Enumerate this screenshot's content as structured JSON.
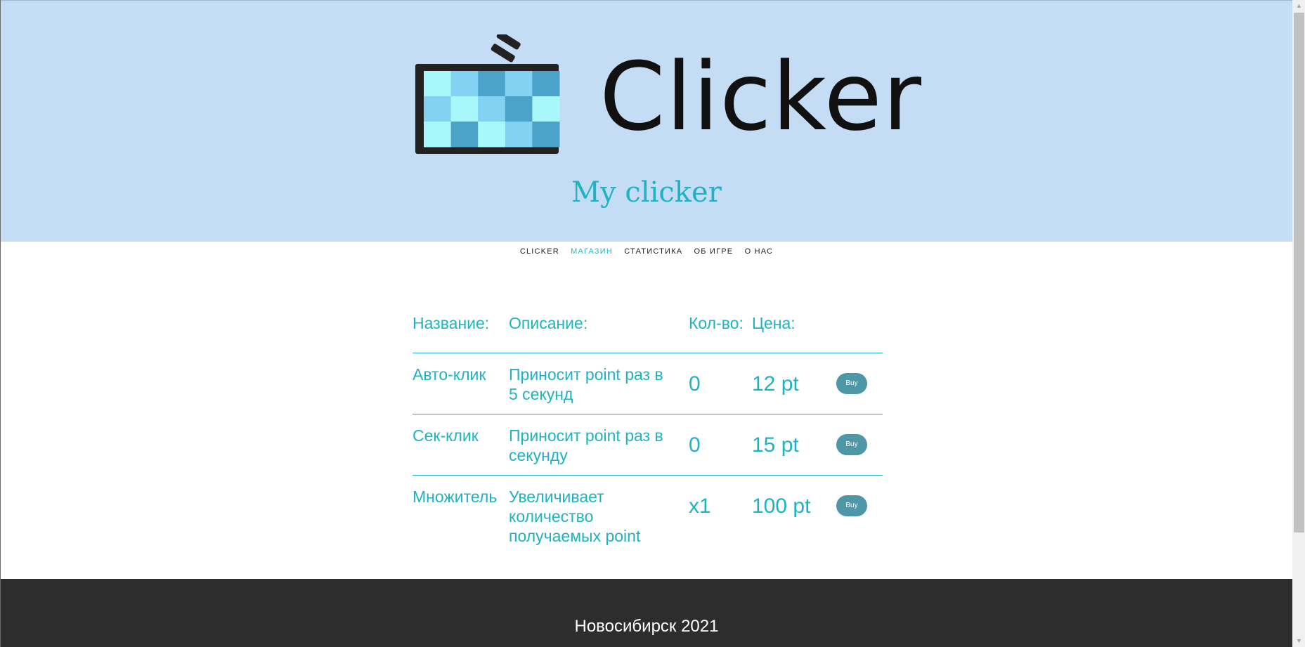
{
  "header": {
    "logo_text": "Clicker",
    "subtitle": "My clicker"
  },
  "nav": {
    "items": [
      {
        "label": "CLICKER",
        "active": false
      },
      {
        "label": "МАГАЗИН",
        "active": true
      },
      {
        "label": "СТАТИСТИКА",
        "active": false
      },
      {
        "label": "ОБ ИГРЕ",
        "active": false
      },
      {
        "label": "О НАС",
        "active": false
      }
    ]
  },
  "shop": {
    "headers": {
      "name": "Название:",
      "description": "Описание:",
      "quantity": "Кол-во:",
      "price": "Цена:"
    },
    "rows": [
      {
        "name": "Авто-клик",
        "description": "Приносит point раз в 5 секунд",
        "quantity": "0",
        "price": "12 pt",
        "button": "Buy"
      },
      {
        "name": "Сек-клик",
        "description": "Приносит point раз в секунду",
        "quantity": "0",
        "price": "15 pt",
        "button": "Buy"
      },
      {
        "name": "Множитель",
        "description": "Увеличивает количество получаемых point",
        "quantity": "x1",
        "price": "100 pt",
        "button": "Buy"
      }
    ]
  },
  "footer": {
    "text": "Новосибирск 2021"
  },
  "colors": {
    "header_bg": "#c5dcf5",
    "accent": "#1fb2c0",
    "button": "#4e97a6",
    "footer_bg": "#2d2d2d",
    "logo_tiles": [
      "#a8f7fb",
      "#83d1f3",
      "#4ba3c9"
    ]
  },
  "icons": {
    "logo": "pixel-monitor-icon",
    "scroll_up": "scroll-up-arrow-icon",
    "scroll_down": "scroll-down-arrow-icon"
  }
}
